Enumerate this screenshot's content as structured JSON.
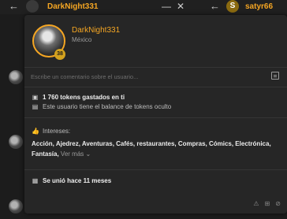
{
  "header": {
    "username": "DarkNight331",
    "other_username": "satyr66",
    "other_initial": "S"
  },
  "profile": {
    "username": "DarkNight331",
    "country": "México",
    "level": "38"
  },
  "comment": {
    "placeholder": "Escribe un comentario sobre el usuario..."
  },
  "tokens": {
    "spent_label": "1 760 tokens gastados en ti",
    "hidden_label": "Este usuario tiene el balance de tokens oculto"
  },
  "interests": {
    "title": "Intereses:",
    "list": "Acción, Ajedrez, Aventuras, Cafés, restaurantes, Compras, Cómics, Electrónica, Fantasía,",
    "more_label": "Ver más"
  },
  "joined": {
    "label": "Se unió hace 11 meses"
  }
}
